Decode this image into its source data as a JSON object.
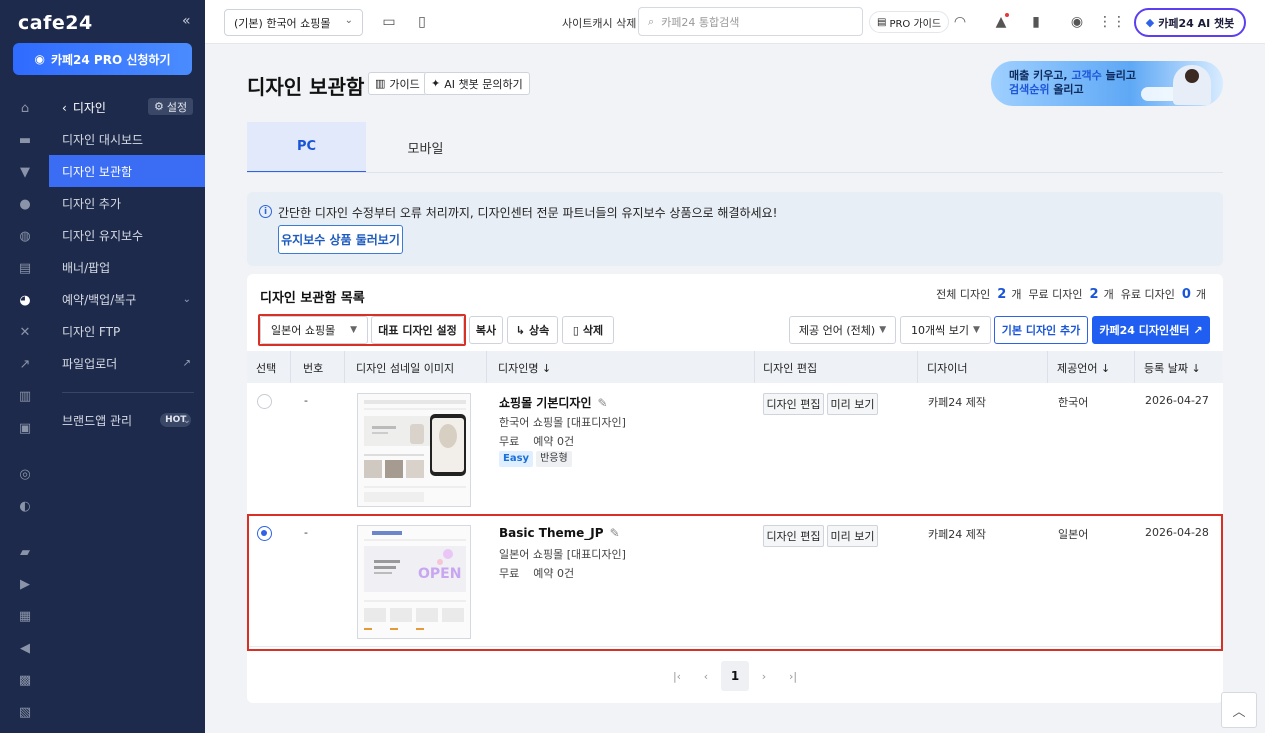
{
  "app": {
    "logo": "cafe24",
    "collapse_icon": "«",
    "pro_button": "카페24 PRO 신청하기"
  },
  "sidebar": {
    "back_label": "디자인",
    "settings_label": "설정",
    "items": [
      {
        "label": "디자인 대시보드",
        "active": false
      },
      {
        "label": "디자인 보관함",
        "active": true
      },
      {
        "label": "디자인 추가",
        "active": false
      },
      {
        "label": "디자인 유지보수",
        "active": false
      },
      {
        "label": "배너/팝업",
        "active": false
      },
      {
        "label": "예약/백업/복구",
        "active": false,
        "expand": true
      },
      {
        "label": "디자인 FTP",
        "active": false
      },
      {
        "label": "파일업로더",
        "active": false,
        "external": true
      }
    ],
    "brand_app": {
      "label": "브랜드앱 관리",
      "badge": "HOT"
    }
  },
  "topbar": {
    "shop_select": "(기본) 한국어 쇼핑몰",
    "cache_label": "사이트캐시 삭제",
    "search_placeholder": "카페24 통합검색",
    "pro_guide": "PRO 가이드",
    "ai_chat": "카페24 AI 챗봇"
  },
  "page": {
    "title": "디자인 보관함",
    "guide_button": "가이드",
    "ai_button": "AI 챗봇 문의하기",
    "banner_line1_a": "매출 키우고, ",
    "banner_line1_b": "고객수",
    "banner_line1_c": " 늘리고",
    "banner_line2_a": "검색순위",
    "banner_line2_b": " 올리고"
  },
  "tabs": [
    {
      "label": "PC",
      "active": true
    },
    {
      "label": "모바일",
      "active": false
    }
  ],
  "info": {
    "text": "간단한 디자인 수정부터 오류 처리까지, 디자인센터 전문 파트너들의 유지보수 상품으로 해결하세요!",
    "button": "유지보수 상품 둘러보기"
  },
  "list": {
    "title": "디자인 보관함 목록",
    "counts": {
      "total_label": "전체 디자인",
      "total": "2",
      "free_label": "무료 디자인",
      "free": "2",
      "paid_label": "유료 디자인",
      "paid": "0",
      "unit": "개"
    },
    "toolbar": {
      "shop_filter": "일본어 쇼핑몰",
      "set_default": "대표 디자인 설정",
      "copy": "복사",
      "inherit": "상속",
      "delete": "삭제",
      "lang_filter": "제공 언어 (전체)",
      "per_page": "10개씩 보기",
      "add_basic": "기본 디자인 추가",
      "design_center": "카페24 디자인센터"
    },
    "columns": [
      "선택",
      "번호",
      "디자인 섬네일 이미지",
      "디자인명",
      "디자인 편집",
      "디자이너",
      "제공언어",
      "등록 날짜"
    ],
    "rows": [
      {
        "selected": false,
        "number": "-",
        "name": "쇼핑몰 기본디자인",
        "shop": "한국어 쇼핑몰 [대표디자인]",
        "price": "무료",
        "reserve": "예약 0건",
        "tags": [
          "Easy",
          "반응형"
        ],
        "edit": "디자인 편집",
        "preview": "미리 보기",
        "designer": "카페24 제작",
        "language": "한국어",
        "date": "2026-04-27"
      },
      {
        "selected": true,
        "number": "-",
        "name": "Basic Theme_JP",
        "shop": "일본어 쇼핑몰 [대표디자인]",
        "price": "무료",
        "reserve": "예약 0건",
        "tags": [],
        "edit": "디자인 편집",
        "preview": "미리 보기",
        "designer": "카페24 제작",
        "language": "일본어",
        "date": "2026-04-28"
      }
    ],
    "pagination": {
      "current": "1"
    }
  }
}
